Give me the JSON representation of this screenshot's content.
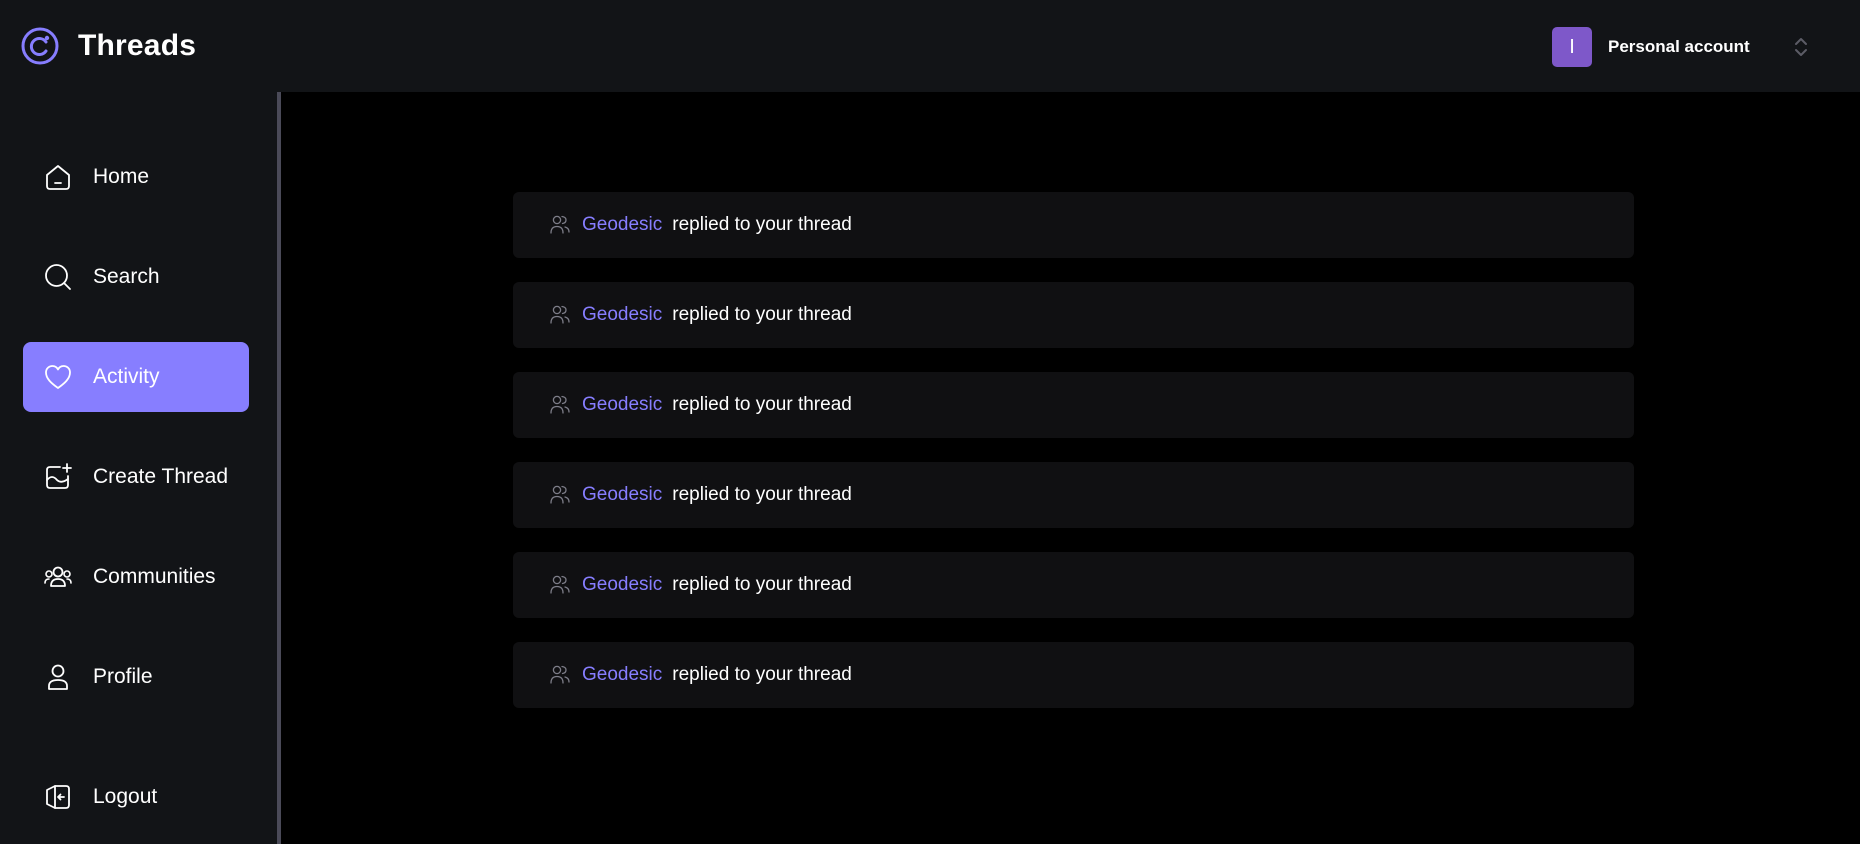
{
  "app": {
    "title": "Threads",
    "logo_icon": "threads-logo-icon"
  },
  "account": {
    "avatar_initial": "I",
    "name": "Personal account",
    "switch_icon": "chevron-up-down-icon"
  },
  "sidebar": {
    "items": [
      {
        "label": "Home",
        "icon": "home-icon",
        "active": false
      },
      {
        "label": "Search",
        "icon": "search-icon",
        "active": false
      },
      {
        "label": "Activity",
        "icon": "heart-icon",
        "active": true
      },
      {
        "label": "Create Thread",
        "icon": "create-thread-icon",
        "active": false
      },
      {
        "label": "Communities",
        "icon": "communities-icon",
        "active": false
      },
      {
        "label": "Profile",
        "icon": "user-icon",
        "active": false
      }
    ],
    "logout": {
      "label": "Logout",
      "icon": "logout-icon"
    }
  },
  "activity": {
    "items": [
      {
        "user": "Geodesic",
        "text": "replied to your thread"
      },
      {
        "user": "Geodesic",
        "text": "replied to your thread"
      },
      {
        "user": "Geodesic",
        "text": "replied to your thread"
      },
      {
        "user": "Geodesic",
        "text": "replied to your thread"
      },
      {
        "user": "Geodesic",
        "text": "replied to your thread"
      },
      {
        "user": "Geodesic",
        "text": "replied to your thread"
      }
    ]
  },
  "colors": {
    "accent": "#877eff",
    "avatar": "#7e58c9",
    "bar_bg": "#121417",
    "card_bg": "#101012"
  }
}
